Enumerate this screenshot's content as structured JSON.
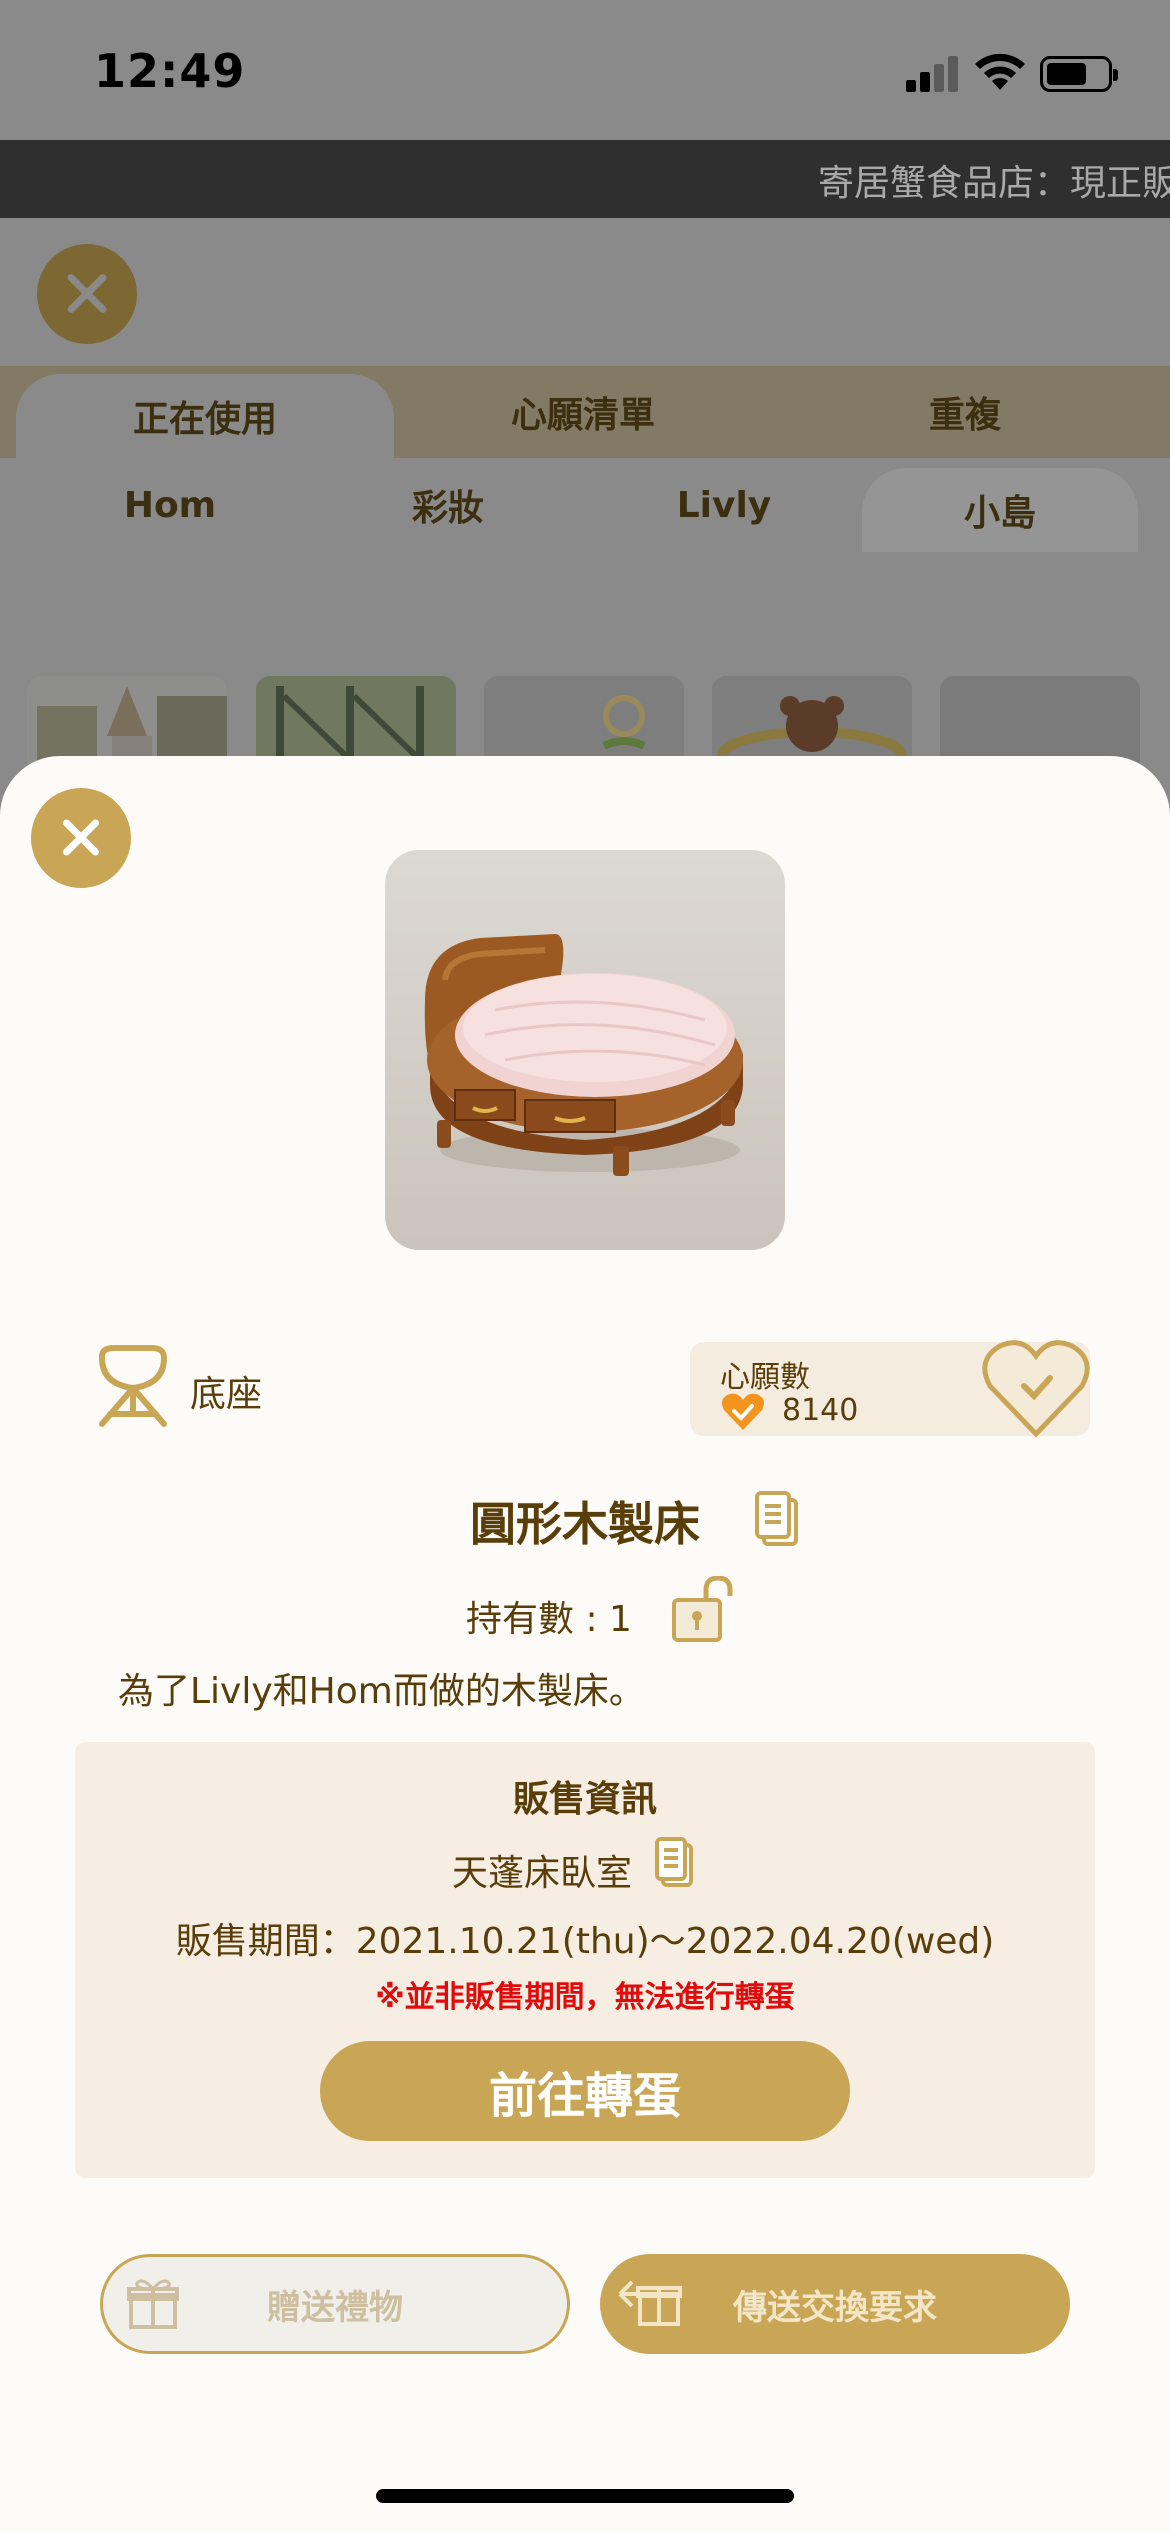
{
  "status_bar": {
    "time": "12:49"
  },
  "ticker": {
    "text": "寄居蟹食品店：現正販"
  },
  "background": {
    "tabs_primary": [
      {
        "label": "正在使用",
        "active": true
      },
      {
        "label": "心願清單",
        "active": false
      },
      {
        "label": "重複",
        "active": false
      }
    ],
    "tabs_secondary": [
      {
        "label": "Hom",
        "active": false
      },
      {
        "label": "彩妝",
        "active": false
      },
      {
        "label": "Livly",
        "active": false
      },
      {
        "label": "小島",
        "active": true
      }
    ]
  },
  "modal": {
    "category": {
      "label": "底座",
      "icon": "base-stand-icon"
    },
    "wishlist": {
      "title": "心願數",
      "count": "8140",
      "icon": "heart-check-icon"
    },
    "item": {
      "name": "圓形木製床",
      "owned_label": "持有數 : 1",
      "description": "為了Livly和Hom而做的木製床。"
    },
    "sales": {
      "title": "販售資訊",
      "gacha_name": "天蓬床臥室",
      "period": "販售期間：2021.10.21(thu)〜2022.04.20(wed)",
      "warning": "※並非販售期間，無法進行轉蛋",
      "go_button": "前往轉蛋"
    },
    "actions": {
      "gift_button": "贈送禮物",
      "trade_button": "傳送交換要求"
    }
  },
  "colors": {
    "accent_gold": "#c9a556",
    "text_brown": "#5a3e0a",
    "warning_red": "#e00b0b",
    "info_bg": "#f6eee3"
  }
}
